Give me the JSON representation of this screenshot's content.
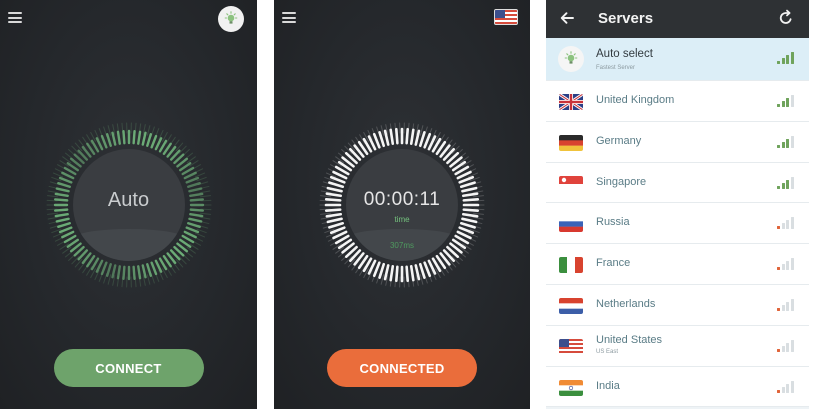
{
  "screens": {
    "home": {
      "center_label": "Auto",
      "button_label": "CONNECT",
      "colors": {
        "ring": "#6fb27a",
        "button": "#6ea36b"
      }
    },
    "connected": {
      "timer": "00:00:11",
      "timer_label": "time",
      "ping": "307ms",
      "button_label": "CONNECTED",
      "colors": {
        "ring": "#ffffff",
        "button": "#ea6d3b"
      }
    },
    "servers": {
      "title": "Servers",
      "items": [
        {
          "name": "Auto select",
          "sub": "Fastest Server",
          "icon": "bulb-icon",
          "signal": 4,
          "signal_color": "#6fa35c"
        },
        {
          "name": "United Kingdom",
          "sub": "",
          "flag": "uk",
          "signal": 3,
          "signal_color": "#6fa35c"
        },
        {
          "name": "Germany",
          "sub": "",
          "flag": "de",
          "signal": 3,
          "signal_color": "#6fa35c"
        },
        {
          "name": "Singapore",
          "sub": "",
          "flag": "sg",
          "signal": 3,
          "signal_color": "#6fa35c"
        },
        {
          "name": "Russia",
          "sub": "",
          "flag": "ru",
          "signal": 1,
          "signal_color": "#e0643a"
        },
        {
          "name": "France",
          "sub": "",
          "flag": "fr",
          "signal": 1,
          "signal_color": "#e0643a"
        },
        {
          "name": "Netherlands",
          "sub": "",
          "flag": "nl",
          "signal": 1,
          "signal_color": "#e0643a"
        },
        {
          "name": "United States",
          "sub": "US East",
          "flag": "us",
          "signal": 1,
          "signal_color": "#e0643a"
        },
        {
          "name": "India",
          "sub": "",
          "flag": "in",
          "signal": 1,
          "signal_color": "#e0643a"
        }
      ]
    }
  }
}
